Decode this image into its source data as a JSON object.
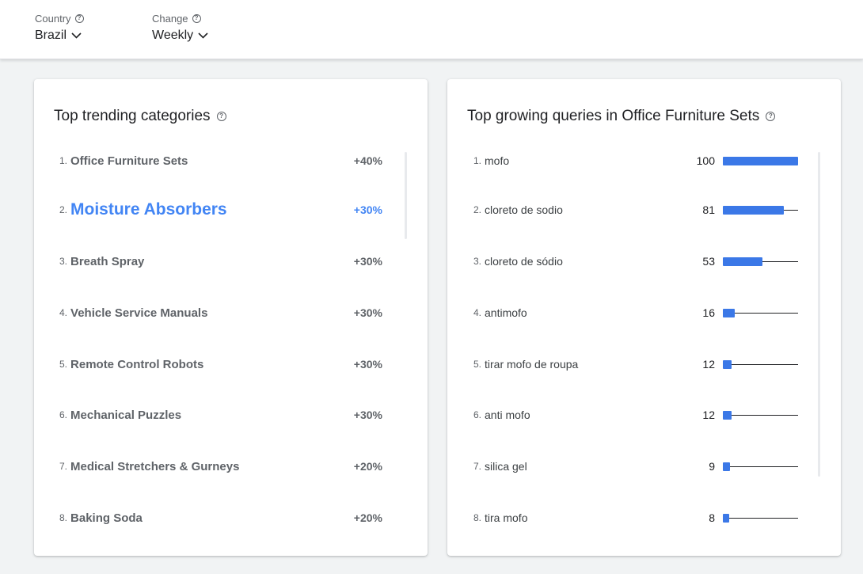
{
  "filters": {
    "country": {
      "label": "Country",
      "value": "Brazil"
    },
    "change": {
      "label": "Change",
      "value": "Weekly"
    }
  },
  "left_card": {
    "title": "Top trending categories",
    "items": [
      {
        "index": "1.",
        "name": "Office Furniture Sets",
        "change": "+40%"
      },
      {
        "index": "2.",
        "name": "Moisture Absorbers",
        "change": "+30%"
      },
      {
        "index": "3.",
        "name": "Breath Spray",
        "change": "+30%"
      },
      {
        "index": "4.",
        "name": "Vehicle Service Manuals",
        "change": "+30%"
      },
      {
        "index": "5.",
        "name": "Remote Control Robots",
        "change": "+30%"
      },
      {
        "index": "6.",
        "name": "Mechanical Puzzles",
        "change": "+30%"
      },
      {
        "index": "7.",
        "name": "Medical Stretchers & Gurneys",
        "change": "+20%"
      },
      {
        "index": "8.",
        "name": "Baking Soda",
        "change": "+20%"
      }
    ],
    "active_index": 1
  },
  "right_card": {
    "title": "Top growing queries in Office Furniture Sets",
    "items": [
      {
        "index": "1.",
        "query": "mofo",
        "value": 100
      },
      {
        "index": "2.",
        "query": "cloreto de sodio",
        "value": 81
      },
      {
        "index": "3.",
        "query": "cloreto de sódio",
        "value": 53
      },
      {
        "index": "4.",
        "query": "antimofo",
        "value": 16
      },
      {
        "index": "5.",
        "query": "tirar mofo de roupa",
        "value": 12
      },
      {
        "index": "6.",
        "query": "anti mofo",
        "value": 12
      },
      {
        "index": "7.",
        "query": "silica gel",
        "value": 9
      },
      {
        "index": "8.",
        "query": "tira mofo",
        "value": 8
      }
    ],
    "max_value": 100
  },
  "colors": {
    "accent": "#4285f4",
    "bar": "#3b78e7",
    "muted_text": "#5f6368",
    "background": "#f1f3f4"
  }
}
